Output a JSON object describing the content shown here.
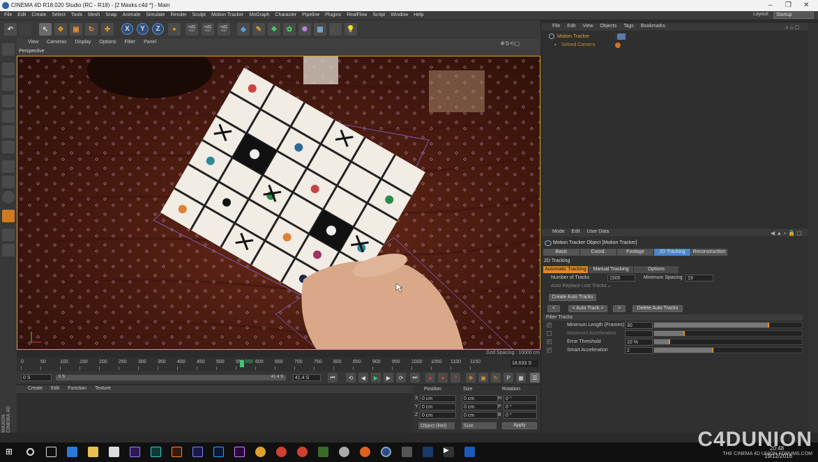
{
  "window": {
    "title": "CINEMA 4D R18.020 Studio (RC - R18) - [2 Masks.c4d *] - Main"
  },
  "menubar": {
    "items": [
      "File",
      "Edit",
      "Create",
      "Select",
      "Tools",
      "Mesh",
      "Snap",
      "Animate",
      "Simulate",
      "Render",
      "Sculpt",
      "Motion Tracker",
      "MoGraph",
      "Character",
      "Pipeline",
      "Plugins",
      "RealFlow",
      "Script",
      "Window",
      "Help"
    ],
    "layout_label": "Layout:",
    "layout_value": "Startup"
  },
  "toolbar": {
    "axis_x": "X",
    "axis_y": "Y",
    "axis_z": "Z"
  },
  "viewport": {
    "menu": [
      "View",
      "Cameras",
      "Display",
      "Options",
      "Filter",
      "Panel"
    ],
    "label": "Perspective",
    "grid_spacing": "Grid Spacing : 10000 cm"
  },
  "timeline": {
    "ticks": [
      "0",
      "50",
      "100",
      "150",
      "200",
      "250",
      "300",
      "350",
      "400",
      "450",
      "500",
      "550",
      "600",
      "650",
      "700",
      "750",
      "800",
      "850",
      "900",
      "950",
      "1000",
      "1050",
      "1100",
      "1150"
    ],
    "end_value": "18,633 S",
    "current_frame": "559",
    "start_field": "0 S",
    "range_start": "0 S",
    "range_end": "41.4 S",
    "range_end2": "41.4 S"
  },
  "material": {
    "menu": [
      "Create",
      "Edit",
      "Function",
      "Texture"
    ]
  },
  "coord": {
    "headers": [
      "Position",
      "Size",
      "Rotation"
    ],
    "rows": [
      {
        "axis": "X",
        "pos": "0 cm",
        "size": "0 cm",
        "rl": "H",
        "rot": "0 °"
      },
      {
        "axis": "Y",
        "pos": "0 cm",
        "size": "0 cm",
        "rl": "P",
        "rot": "0 °"
      },
      {
        "axis": "Z",
        "pos": "0 cm",
        "size": "0 cm",
        "rl": "B",
        "rot": "0 °"
      }
    ],
    "mode": "Object (Rel)",
    "size_mode": "Size",
    "apply": "Apply"
  },
  "objmgr": {
    "menu": [
      "File",
      "Edit",
      "View",
      "Objects",
      "Tags",
      "Bookmarks"
    ],
    "objects": [
      {
        "name": "Motion Tracker"
      },
      {
        "name": "Solved Camera"
      }
    ]
  },
  "attr": {
    "menu": [
      "Mode",
      "Edit",
      "User Data"
    ],
    "object_title": "Motion Tracker Object [Motion Tracker]",
    "tabs": [
      "Basic",
      "Coord.",
      "Footage",
      "2D Tracking",
      "Reconstruction"
    ],
    "section": "2D Tracking",
    "subtabs": [
      "Automatic Tracking",
      "Manual Tracking",
      "Options"
    ],
    "num_tracks_label": "Number of Tracks",
    "num_tracks": "1500",
    "min_spacing_label": "Minimum Spacing",
    "min_spacing": "19",
    "auto_replace_label": "Auto Replace Lost Tracks",
    "create_auto": "Create Auto Tracks",
    "btn_prev": "<",
    "btn_auto": "< Auto Track >",
    "btn_next": ">",
    "delete_auto": "Delete Auto Tracks",
    "filter_section": "Filter Tracks",
    "filters": [
      {
        "label": "Minimum Length (Frames)",
        "value": "30",
        "fill": 0.77
      },
      {
        "label": "Maximum Acceleration",
        "value": "",
        "fill": 0.2
      },
      {
        "label": "Error Threshold",
        "value": "10 %",
        "fill": 0.1
      },
      {
        "label": "Smart Acceleration",
        "value": "2",
        "fill": 0.39
      }
    ]
  },
  "taskbar": {
    "time": "20:48",
    "date": "19/12/2016"
  },
  "watermark": {
    "brand": "C4DUNION",
    "tag": "THE CINEMA 4D UNION FORUMS.COM"
  },
  "logo": "MAXON CINEMA 4D",
  "colors": {
    "accent": "#4a86c8",
    "orange": "#e08a20",
    "frame": "#d9a520"
  }
}
